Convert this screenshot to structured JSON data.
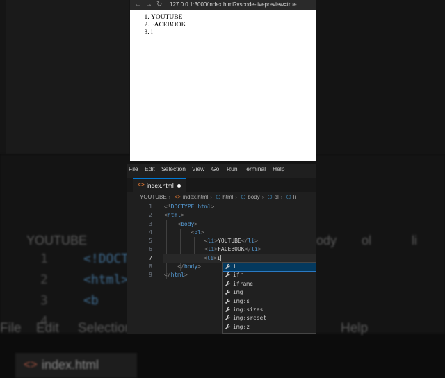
{
  "browser": {
    "url": "127.0.0.1:3000/index.html?vscode-livepreview=true",
    "back": "←",
    "forward": "→",
    "reload": "↻",
    "list": [
      "YOUTUBE",
      "FACEBOOK",
      "i"
    ]
  },
  "menu": [
    "File",
    "Edit",
    "Selection",
    "View",
    "Go",
    "Run",
    "Terminal",
    "Help"
  ],
  "background_menu": [
    "File",
    "Edit",
    "Selection",
    "al",
    "Help"
  ],
  "tab": {
    "icon": "<>",
    "name": "index.html"
  },
  "breadcrumb": [
    "YOUTUBE",
    "index.html",
    "html",
    "body",
    "ol",
    "li"
  ],
  "background_breadcrumb": [
    "YOUTUBE",
    "ody",
    "ol",
    "li"
  ],
  "background_code": [
    "<!DOCT",
    "<html>",
    "<b",
    ""
  ],
  "background_line_numbers": [
    "1",
    "2",
    "3",
    "4"
  ],
  "line_numbers": [
    "1",
    "2",
    "3",
    "4",
    "5",
    "6",
    "7",
    "8",
    "9"
  ],
  "code_lines": [
    {
      "indent": "",
      "parts": [
        [
          "tg",
          "<!"
        ],
        [
          "tn",
          "DOCTYPE"
        ],
        [
          "tx",
          " "
        ],
        [
          "tn",
          "html"
        ],
        [
          "tg",
          ">"
        ]
      ]
    },
    {
      "indent": "",
      "parts": [
        [
          "tg",
          "<"
        ],
        [
          "tn",
          "html"
        ],
        [
          "tg",
          ">"
        ]
      ]
    },
    {
      "indent": "    ",
      "parts": [
        [
          "tg",
          "<"
        ],
        [
          "tn",
          "body"
        ],
        [
          "tg",
          ">"
        ]
      ]
    },
    {
      "indent": "        ",
      "parts": [
        [
          "tg",
          "<"
        ],
        [
          "tn",
          "ol"
        ],
        [
          "tg",
          ">"
        ]
      ]
    },
    {
      "indent": "            ",
      "parts": [
        [
          "tg",
          "<"
        ],
        [
          "tn",
          "li"
        ],
        [
          "tg",
          ">"
        ],
        [
          "tx",
          "YOUTUBE"
        ],
        [
          "tg",
          "</"
        ],
        [
          "tn",
          "li"
        ],
        [
          "tg",
          ">"
        ]
      ]
    },
    {
      "indent": "            ",
      "parts": [
        [
          "tg",
          "<"
        ],
        [
          "tn",
          "li"
        ],
        [
          "tg",
          ">"
        ],
        [
          "tx",
          "FACEBOOK"
        ],
        [
          "tg",
          "</"
        ],
        [
          "tn",
          "li"
        ],
        [
          "tg",
          ">"
        ]
      ]
    },
    {
      "indent": "            ",
      "parts": [
        [
          "tg",
          "<"
        ],
        [
          "tn",
          "li"
        ],
        [
          "tg",
          ">"
        ],
        [
          "tx",
          "i"
        ]
      ]
    },
    {
      "indent": "    ",
      "parts": [
        [
          "tg",
          "</"
        ],
        [
          "tn",
          "body"
        ],
        [
          "tg",
          ">"
        ]
      ]
    },
    {
      "indent": "",
      "parts": [
        [
          "tg",
          "</"
        ],
        [
          "tn",
          "html"
        ],
        [
          "tg",
          ">"
        ]
      ]
    }
  ],
  "current_line": 7,
  "suggestions": [
    "i",
    "ifr",
    "iframe",
    "img",
    "img:s",
    "img:sizes",
    "img:srcset",
    "img:z"
  ],
  "suggestion_icon": "wrench-icon",
  "colors": {
    "tag_bracket": "#808080",
    "tag_name": "#569cd6",
    "text": "#d4d4d4",
    "accent": "#0078d4"
  }
}
